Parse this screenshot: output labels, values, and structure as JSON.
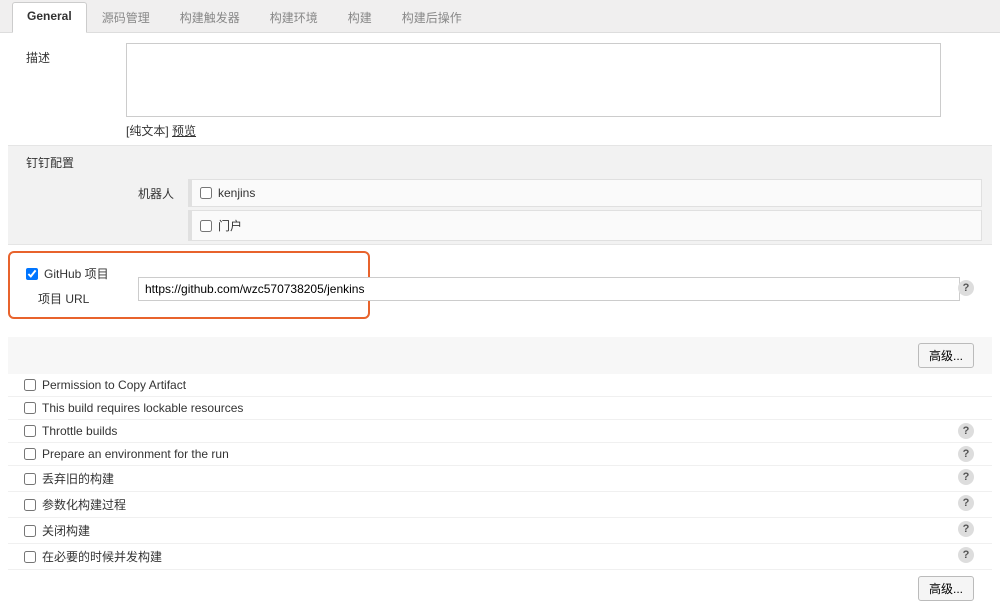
{
  "tabs": {
    "general": "General",
    "scm": "源码管理",
    "triggers": "构建触发器",
    "env": "构建环境",
    "build": "构建",
    "post": "构建后操作"
  },
  "desc": {
    "label": "描述",
    "value": "",
    "format_prefix": "[纯文本] ",
    "preview": "预览"
  },
  "dingding": {
    "title": "钉钉配置",
    "robot_label": "机器人",
    "opt_kenjins": "kenjins",
    "opt_portal": "门户"
  },
  "github": {
    "checkbox_label": "GitHub 项目",
    "url_label": "项目 URL",
    "url_value": "https://github.com/wzc570738205/jenkins"
  },
  "advanced_label": "高级...",
  "options": {
    "copy_artifact": "Permission to Copy Artifact",
    "lockable": "This build requires lockable resources",
    "throttle": "Throttle builds",
    "prepare_env": "Prepare an environment for the run",
    "discard_old": "丢弃旧的构建",
    "parameterized": "参数化构建过程",
    "close_build": "关闭构建",
    "concurrent": "在必要的时候并发构建"
  },
  "help_glyph": "?"
}
